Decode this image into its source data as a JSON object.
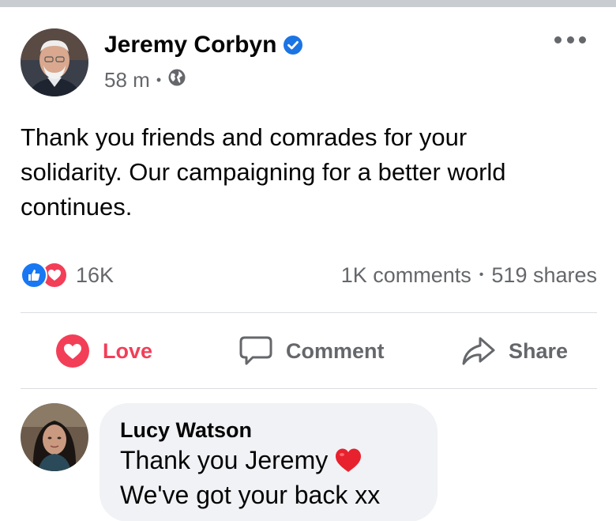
{
  "post": {
    "author": "Jeremy Corbyn",
    "time": "58 m",
    "meta_separator": "•",
    "text_lines": [
      "Thank you friends and comrades for your",
      "solidarity. Our campaigning for a better world",
      "continues."
    ]
  },
  "stats": {
    "reaction_count": "16K",
    "comments": "1K comments",
    "separator": "•",
    "shares": "519 shares"
  },
  "actions": {
    "love": "Love",
    "comment": "Comment",
    "share": "Share"
  },
  "comment": {
    "author": "Lucy Watson",
    "line1": "Thank you Jeremy",
    "line2": "We've got your back xx"
  },
  "colors": {
    "love_red": "#f33e58",
    "like_blue": "#1877f2",
    "verified_blue": "#1b74e4",
    "muted_gray": "#65676b",
    "bubble_bg": "#f0f2f5"
  },
  "icons": {
    "verified": "verified-badge-icon",
    "privacy": "globe-icon",
    "more": "more-options-icon",
    "like_reaction": "like-reaction-icon",
    "love_reaction": "love-reaction-icon",
    "love_action": "heart-icon",
    "comment_action": "comment-bubble-icon",
    "share_action": "share-arrow-icon",
    "comment_emoji": "red-heart-emoji-icon"
  }
}
